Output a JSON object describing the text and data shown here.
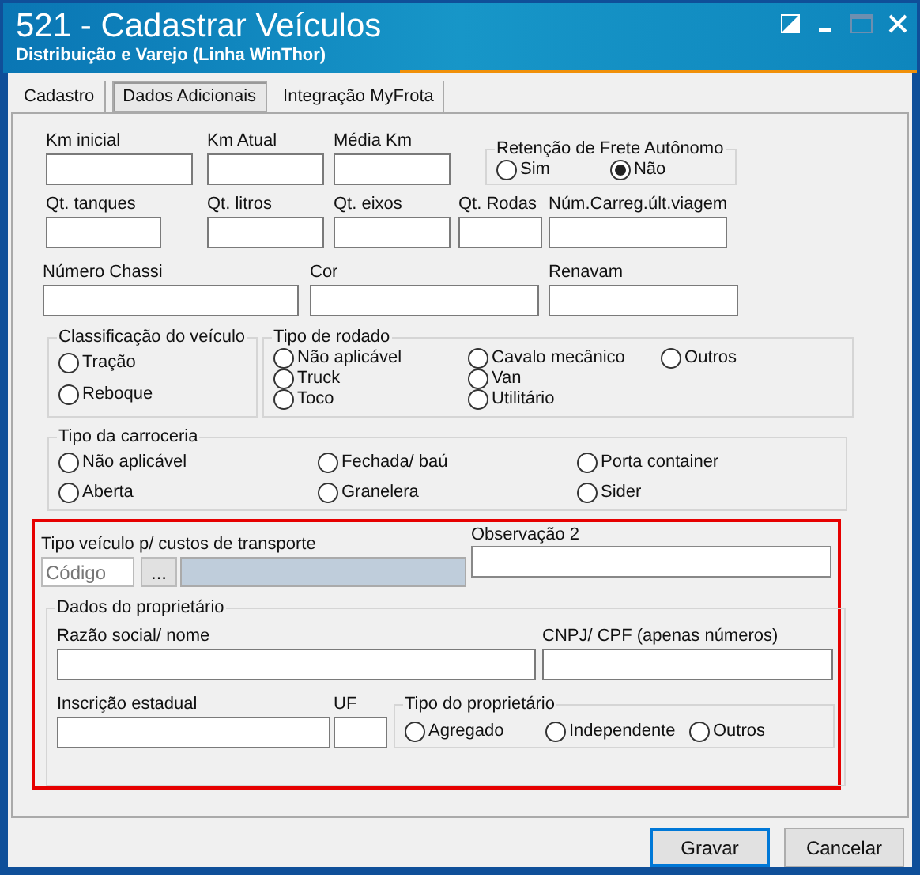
{
  "window": {
    "title": "521 - Cadastrar Veículos",
    "subtitle": "Distribuição e Varejo (Linha WinThor)"
  },
  "tabs": [
    {
      "label": "Cadastro",
      "selected": false
    },
    {
      "label": "Dados Adicionais",
      "selected": true
    },
    {
      "label": "Integração MyFrota",
      "selected": false
    }
  ],
  "field_rows": [
    [
      {
        "label": "Km inicial"
      },
      {
        "label": "Km Atual"
      },
      {
        "label": "Média Km"
      }
    ],
    [
      {
        "label": "Qt. tanques"
      },
      {
        "label": "Qt. litros"
      },
      {
        "label": "Qt. eixos"
      },
      {
        "label": "Qt. Rodas"
      },
      {
        "label": "Núm.Carreg.últ.viagem"
      }
    ],
    [
      {
        "label": "Número Chassi"
      },
      {
        "label": "Cor"
      },
      {
        "label": "Renavam"
      }
    ]
  ],
  "retencao_frete": {
    "title": "Retenção de Frete Autônomo",
    "options": [
      {
        "label": "Sim",
        "selected": false
      },
      {
        "label": "Não",
        "selected": true
      }
    ]
  },
  "classificacao_veiculo": {
    "title": "Classificação do veículo",
    "options": [
      {
        "label": "Tração",
        "selected": false
      },
      {
        "label": "Reboque",
        "selected": false
      }
    ]
  },
  "tipo_rodado": {
    "title": "Tipo de rodado",
    "columns": [
      [
        {
          "label": "Não aplicável",
          "selected": false
        },
        {
          "label": "Truck",
          "selected": false
        },
        {
          "label": "Toco",
          "selected": false
        }
      ],
      [
        {
          "label": "Cavalo mecânico",
          "selected": false
        },
        {
          "label": "Van",
          "selected": false
        },
        {
          "label": "Utilitário",
          "selected": false
        }
      ],
      [
        {
          "label": "Outros",
          "selected": false
        }
      ]
    ]
  },
  "tipo_carroceria": {
    "title": "Tipo da carroceria",
    "columns": [
      [
        {
          "label": "Não aplicável",
          "selected": false
        },
        {
          "label": "Aberta",
          "selected": false
        }
      ],
      [
        {
          "label": "Fechada/ baú",
          "selected": false
        },
        {
          "label": "Granelera",
          "selected": false
        }
      ],
      [
        {
          "label": "Porta container",
          "selected": false
        },
        {
          "label": "Sider",
          "selected": false
        }
      ]
    ]
  },
  "tipo_veiculo_custos": {
    "label": "Tipo veículo p/ custos de transporte",
    "code_placeholder": "Código",
    "lookup_button": "..."
  },
  "observacao_2": {
    "label": "Observação 2"
  },
  "dados_proprietario": {
    "title": "Dados do proprietário",
    "razao_social": {
      "label": "Razão social/ nome"
    },
    "cnpj_cpf": {
      "label": "CNPJ/ CPF (apenas números)"
    },
    "inscricao_estadual": {
      "label": "Inscrição estadual"
    },
    "uf": {
      "label": "UF"
    },
    "tipo_proprietario": {
      "title": "Tipo do proprietário",
      "options": [
        {
          "label": "Agregado",
          "selected": false
        },
        {
          "label": "Independente",
          "selected": false
        },
        {
          "label": "Outros",
          "selected": false
        }
      ]
    }
  },
  "buttons": [
    {
      "label": "Gravar",
      "default": true
    },
    {
      "label": "Cancelar",
      "default": false
    }
  ]
}
